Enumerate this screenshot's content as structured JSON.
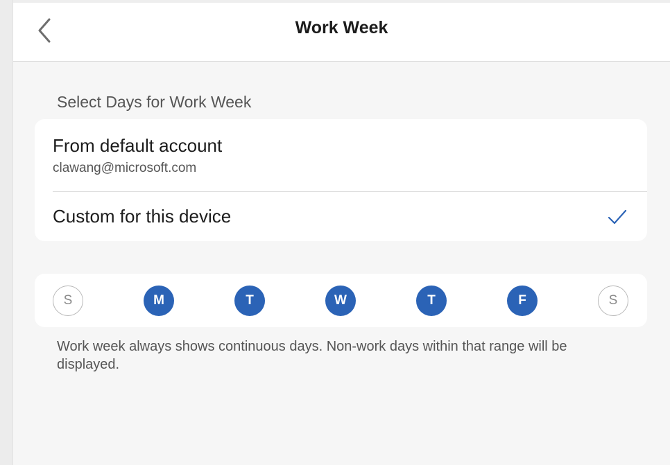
{
  "header": {
    "title": "Work Week",
    "back_icon": "chevron-left-icon"
  },
  "section": {
    "header": "Select Days for Work Week"
  },
  "options": [
    {
      "title": "From default account",
      "subtitle": "clawang@microsoft.com",
      "selected": false
    },
    {
      "title": "Custom for this device",
      "selected": true,
      "check_icon": "checkmark-icon"
    }
  ],
  "days": [
    {
      "letter": "S",
      "selected": false
    },
    {
      "letter": "M",
      "selected": true
    },
    {
      "letter": "T",
      "selected": true
    },
    {
      "letter": "W",
      "selected": true
    },
    {
      "letter": "T",
      "selected": true
    },
    {
      "letter": "F",
      "selected": true
    },
    {
      "letter": "S",
      "selected": false
    }
  ],
  "footnote": "Work week always shows continuous days. Non-work days within that range will be displayed.",
  "colors": {
    "accent": "#2b63b6",
    "background": "#f6f6f6",
    "card": "#ffffff"
  }
}
